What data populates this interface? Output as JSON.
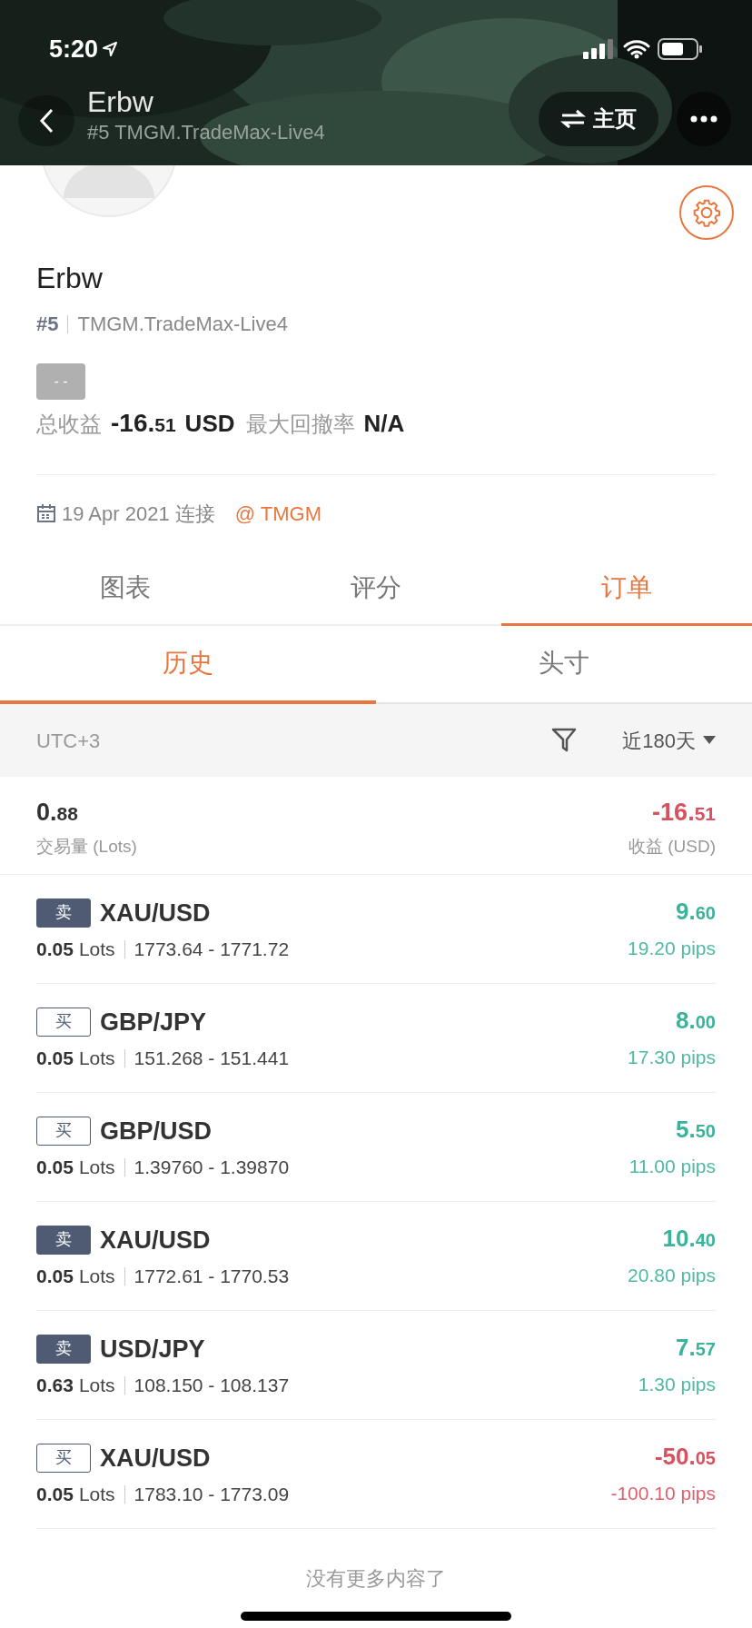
{
  "status_bar": {
    "time": "5:20"
  },
  "nav": {
    "title": "Erbw",
    "subtitle": "#5 TMGM.TradeMax-Live4",
    "home_button": "主页"
  },
  "profile": {
    "name": "Erbw",
    "rank": "#5",
    "server": "TMGM.TradeMax-Live4",
    "badge": "- -",
    "total_label": "总收益",
    "total_value": "-16.51",
    "total_unit": "USD",
    "drawdown_label": "最大回撤率",
    "drawdown_value": "N/A",
    "date": "19 Apr 2021 连接",
    "broker": "@ TMGM"
  },
  "tabs": [
    {
      "label": "图表",
      "selected": false
    },
    {
      "label": "评分",
      "selected": false
    },
    {
      "label": "订单",
      "selected": true
    }
  ],
  "subtabs": [
    {
      "label": "历史",
      "selected": true
    },
    {
      "label": "头寸",
      "selected": false
    }
  ],
  "filter_bar": {
    "timezone": "UTC+3",
    "period": "近180天"
  },
  "summary": {
    "volume": "0.88",
    "volume_label": "交易量 (Lots)",
    "profit": "-16.51",
    "profit_label": "收益 (USD)",
    "color": "#d9505f"
  },
  "orders": [
    {
      "side": "卖",
      "kind": "sell",
      "symbol": "XAU/USD",
      "lots": "0.05",
      "lots_unit": "Lots",
      "prices": "1773.64 - 1771.72",
      "profit": "9.60",
      "pips": "19.20 pips",
      "color": "#3bb39b"
    },
    {
      "side": "买",
      "kind": "buy",
      "symbol": "GBP/JPY",
      "lots": "0.05",
      "lots_unit": "Lots",
      "prices": "151.268 - 151.441",
      "profit": "8.00",
      "pips": "17.30 pips",
      "color": "#3bb39b"
    },
    {
      "side": "买",
      "kind": "buy",
      "symbol": "GBP/USD",
      "lots": "0.05",
      "lots_unit": "Lots",
      "prices": "1.39760 - 1.39870",
      "profit": "5.50",
      "pips": "11.00 pips",
      "color": "#3bb39b"
    },
    {
      "side": "卖",
      "kind": "sell",
      "symbol": "XAU/USD",
      "lots": "0.05",
      "lots_unit": "Lots",
      "prices": "1772.61 - 1770.53",
      "profit": "10.40",
      "pips": "20.80 pips",
      "color": "#3bb39b"
    },
    {
      "side": "卖",
      "kind": "sell",
      "symbol": "USD/JPY",
      "lots": "0.63",
      "lots_unit": "Lots",
      "prices": "108.150 - 108.137",
      "profit": "7.57",
      "pips": "1.30 pips",
      "color": "#3bb39b"
    },
    {
      "side": "买",
      "kind": "buy",
      "symbol": "XAU/USD",
      "lots": "0.05",
      "lots_unit": "Lots",
      "prices": "1783.10 - 1773.09",
      "profit": "-50.05",
      "pips": "-100.10 pips",
      "color": "#d9505f"
    }
  ],
  "footer": "没有更多内容了"
}
